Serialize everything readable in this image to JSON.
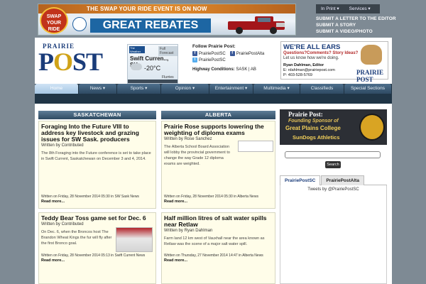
{
  "ad_banner": {
    "logo_line1": "SWAP",
    "logo_line2": "YOUR",
    "logo_line3": "RIDE",
    "headline": "THE SWAP YOUR RIDE EVENT IS ON NOW",
    "offer": "GREAT REBATES"
  },
  "util_menu": {
    "items": [
      "In Print ▾",
      "Services ▾"
    ],
    "links": [
      "SUBMIT A LETTER TO THE EDITOR",
      "SUBMIT A STORY",
      "SUBMIT A VIDEO/PHOTO"
    ]
  },
  "logo": {
    "top": "PRAIRIE",
    "main_p": "P",
    "main_o": "O",
    "main_st": "ST"
  },
  "weather": {
    "brand": "The Weather Network",
    "forecast_label": "Full Forecast",
    "city": "Swift Curren.., SK",
    "temp": "-20°C",
    "condition": "Flurries"
  },
  "follow": {
    "title": "Follow Prairie Post:",
    "accounts": [
      "PrairiePostSC",
      "PrairiePostAlta",
      "PrairiePostSC"
    ],
    "highway_label": "Highway Conditions:",
    "highway_links": "SASK | AB"
  },
  "ad_ears": {
    "headline": "WE'RE ALL EARS",
    "sub": "Questions?Comments? Story Ideas?",
    "note": "Let us know how we're doing.",
    "editor": "Ryan Dahlman, Editor",
    "email": "E: rdahlman@prairiepost.com",
    "phone": "P: 403-528-5769",
    "brand": "PRAIRIE POST"
  },
  "nav": {
    "items": [
      "Home",
      "News ▾",
      "Sports ▾",
      "Opinion ▾",
      "Entertainment ▾",
      "Multimedia ▾",
      "Classifieds",
      "Special Sections"
    ]
  },
  "columns": {
    "sask_heading": "SASKATCHEWAN",
    "alberta_heading": "ALBERTA"
  },
  "articles": {
    "sask1": {
      "title": "Foraging Into the Future VIII to address key livestock and grazing issues for SW Sask. producers",
      "author": "Written by Contributed",
      "body": "The 8th Foraging into the Future conference is set to take place in Swift Current, Saskatchewan on December 3 and 4, 2014.",
      "meta": "Written on Friday, 28 November 2014 05:30 in SW Sask News",
      "more": "Read more..."
    },
    "ab1": {
      "title": "Prairie Rose supports lowering the weighting of diploma exams",
      "author": "Written by Rose Sanchez",
      "body": "The Alberta School Board Association will lobby the provincial government to change the way Grade 12 diploma exams are weighted.",
      "meta": "Written on Friday, 28 November 2014 05:30 in Alberta News",
      "more": "Read more..."
    },
    "sask2": {
      "title": "Teddy Bear Toss game set for Dec. 6",
      "author": "Written by Contributed",
      "body": "On Dec. 6, when the Broncos host The Brandon Wheat Kings the fur will fly after the first Bronco goal.",
      "meta": "Written on Friday, 28 November 2014 05:13 in Swift Current News",
      "more": "Read more..."
    },
    "ab2": {
      "title": "Half million litres of salt water spills near Retlaw",
      "author": "Written by Ryan Dahlman",
      "body": "Farm land 12 km west of Vauxhall near the area known as Retlaw was the scene of a major salt water spill.",
      "meta": "Written on Thursday, 27 November 2014 14:47 in Alberta News",
      "more": "Read more..."
    }
  },
  "sidebar": {
    "ad_line1": "Prairie Post:",
    "ad_line2": "Founding Sponsor of",
    "ad_line3": "Great Plains College",
    "ad_line4": "SunDogs Athletics",
    "search_placeholder": "",
    "search_button": "Search",
    "tabs": [
      "PrairiePostSC",
      "PrairiePostAlta"
    ],
    "tweets_by": "Tweets by @PrairiePostSC"
  }
}
